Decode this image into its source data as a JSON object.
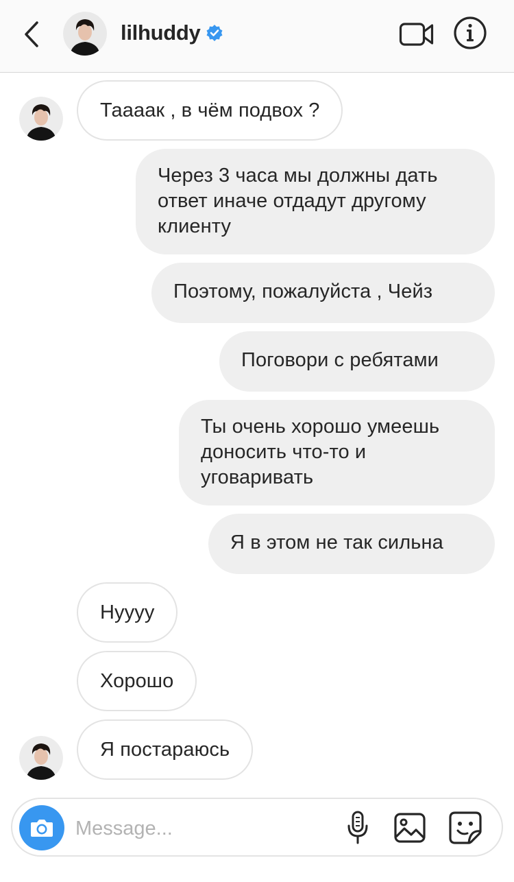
{
  "header": {
    "username": "lilhuddy",
    "verified": true,
    "accent_color": "#3897f0"
  },
  "icons": {
    "back": "chevron-left-icon",
    "verified": "verified-badge-icon",
    "video": "video-camera-icon",
    "info": "info-icon",
    "camera": "camera-icon",
    "mic": "microphone-icon",
    "gallery": "gallery-icon",
    "sticker": "sticker-icon"
  },
  "messages": [
    {
      "direction": "in",
      "text": "Тааaак , в чём подвох ?"
    },
    {
      "direction": "out",
      "lines": [
        "Через 3 часа мы должны дать",
        "ответ иначе отдадут другому",
        "клиенту"
      ]
    },
    {
      "direction": "out",
      "text": "Поэтому, пожалуйста , Чейз"
    },
    {
      "direction": "out",
      "text": "Поговори с ребятами"
    },
    {
      "direction": "out",
      "lines": [
        "Ты очень хорошо умеешь",
        "доносить что-то и",
        "уговаривать"
      ]
    },
    {
      "direction": "out",
      "text": "Я в этом не так сильна"
    },
    {
      "direction": "in",
      "text": "Нуууу"
    },
    {
      "direction": "in",
      "text": "Хорошо"
    },
    {
      "direction": "in",
      "text": "Я постараюсь"
    }
  ],
  "composer": {
    "placeholder": "Message..."
  }
}
